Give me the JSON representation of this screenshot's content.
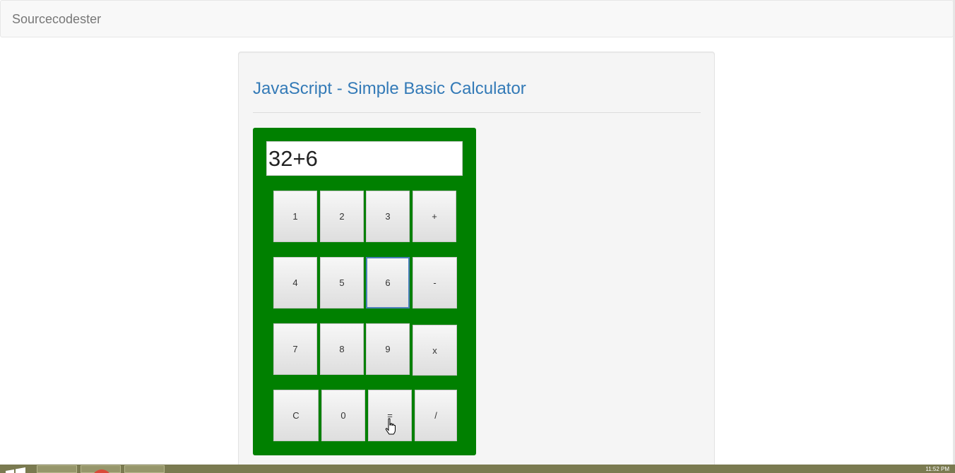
{
  "navbar": {
    "brand": "Sourcecodester"
  },
  "page": {
    "title": "JavaScript - Simple Basic Calculator"
  },
  "calculator": {
    "display_value": "32+6",
    "keys": [
      "1",
      "2",
      "3",
      "+",
      "4",
      "5",
      "6",
      "-",
      "7",
      "8",
      "9",
      "x",
      "C",
      "0",
      "=",
      "/"
    ],
    "focused_key": "6",
    "background_color": "#008000"
  },
  "taskbar": {
    "clock": "11:52 PM"
  }
}
